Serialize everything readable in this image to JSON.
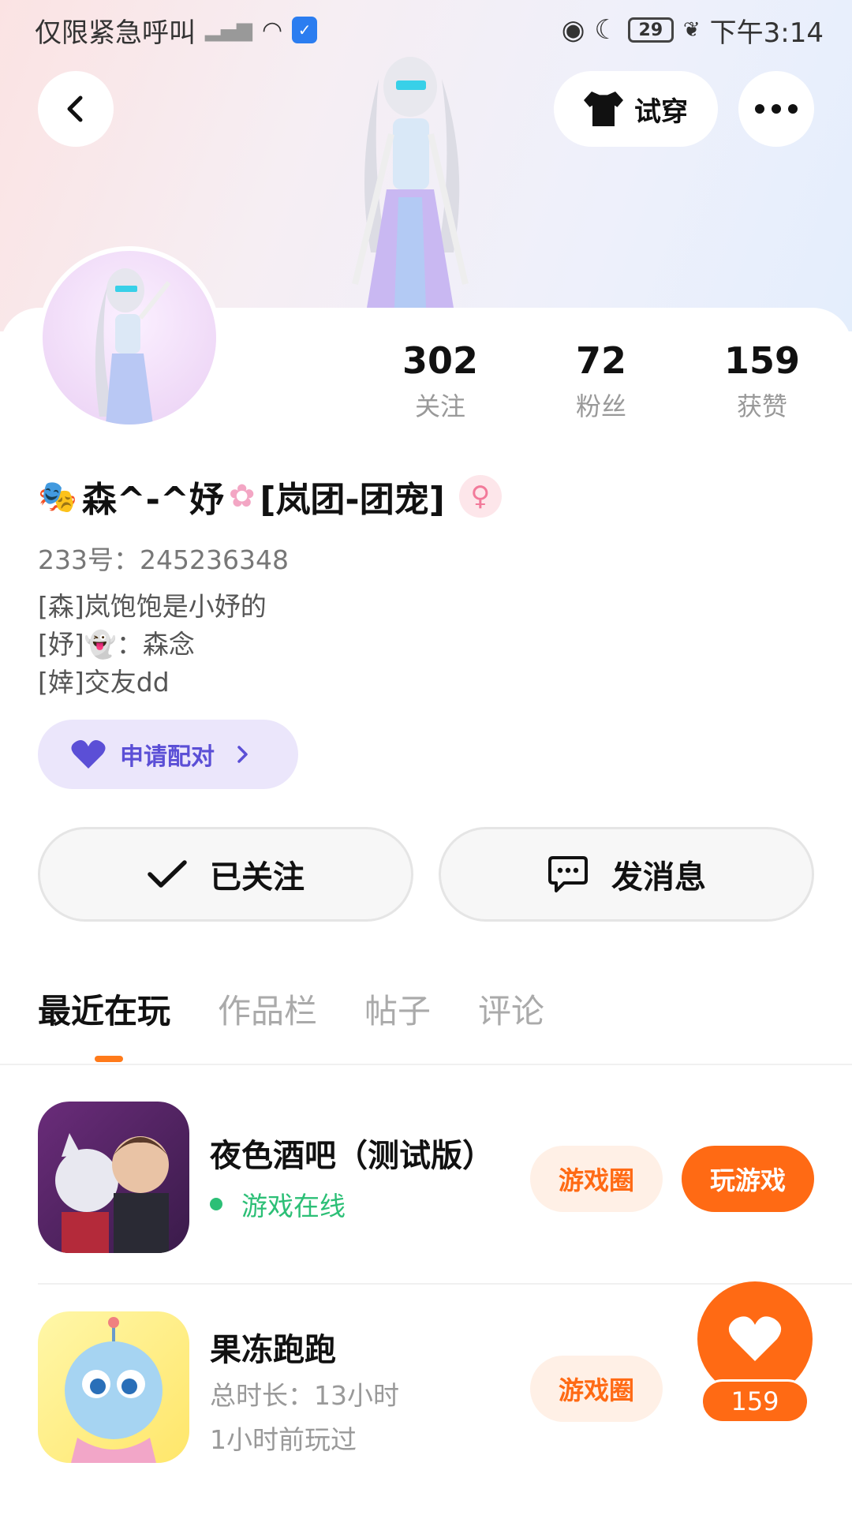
{
  "status_bar": {
    "carrier": "仅限紧急呼叫",
    "battery": "29",
    "time": "下午3:14"
  },
  "header": {
    "try_on_label": "试穿"
  },
  "stats": [
    {
      "value": "302",
      "label": "关注"
    },
    {
      "value": "72",
      "label": "粉丝"
    },
    {
      "value": "159",
      "label": "获赞"
    }
  ],
  "profile": {
    "name": "森^-^妤",
    "name_suffix": "[岚团-团宠]",
    "gender_symbol": "♀",
    "uid": "233号：245236348",
    "bio": [
      "[森]岚饱饱是小妤的",
      "[妤]👻：森念",
      "[婞]交友dd"
    ]
  },
  "pair_button": {
    "label": "申请配对"
  },
  "actions": {
    "followed_label": "已关注",
    "message_label": "发消息"
  },
  "tabs": [
    {
      "label": "最近在玩",
      "active": true
    },
    {
      "label": "作品栏",
      "active": false
    },
    {
      "label": "帖子",
      "active": false
    },
    {
      "label": "评论",
      "active": false
    }
  ],
  "games": [
    {
      "title": "夜色酒吧（测试版）",
      "status": "游戏在线",
      "circle_label": "游戏圈",
      "play_label": "玩游戏"
    },
    {
      "title": "果冻跑跑",
      "duration": "总时长：13小时",
      "last_played": "1小时前玩过",
      "circle_label": "游戏圈"
    }
  ],
  "like_fab": {
    "count": "159"
  },
  "colors": {
    "accent": "#ff6a14",
    "pair_purple": "#5b4fd6",
    "online_green": "#2cbf76"
  }
}
